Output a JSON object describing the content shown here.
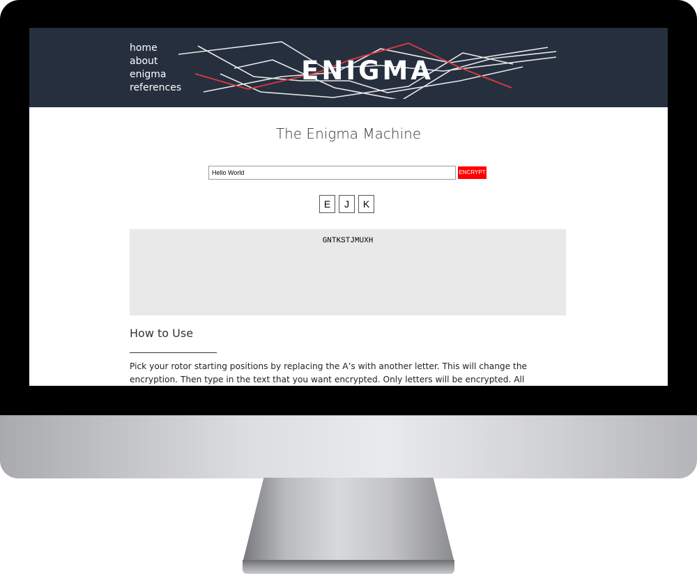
{
  "nav": {
    "items": [
      {
        "label": "home"
      },
      {
        "label": "about"
      },
      {
        "label": "enigma"
      },
      {
        "label": "references"
      }
    ]
  },
  "logo": {
    "text": "ENIGMA",
    "line_color": "#e8e8e8",
    "accent_color": "#e0393e"
  },
  "main": {
    "title": "The Enigma Machine",
    "message_input": {
      "value": "Hello World"
    },
    "encrypt_button": {
      "label": "ENCRYPT"
    },
    "rotors": [
      {
        "value": "E"
      },
      {
        "value": "J"
      },
      {
        "value": "K"
      }
    ],
    "output": "GNTKSTJMUXH",
    "how_to_use": {
      "heading": "How to Use",
      "paragraph": "Pick your rotor starting positions by replacing the A’s with another letter. This will change the encryption. Then type in the text that you want encrypted. Only letters will be encrypted. All punctuation and spaces will"
    }
  },
  "colors": {
    "header_bg": "#262f3e",
    "button_bg": "#ff0000",
    "output_bg": "#e9e9e9"
  }
}
